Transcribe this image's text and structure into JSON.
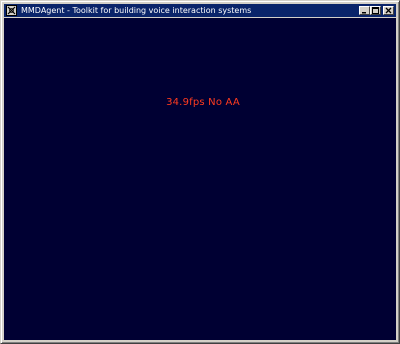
{
  "window": {
    "title": "MMDAgent - Toolkit for building voice interaction systems",
    "app_icon": "mmdagent-app-icon",
    "caption_buttons": {
      "minimize_icon": "minimize-icon",
      "maximize_icon": "maximize-icon",
      "close_icon": "close-icon"
    }
  },
  "viewport": {
    "background_color": "#000033",
    "status_text": "34.9fps No AA",
    "status_color": "#ff3b1f"
  }
}
